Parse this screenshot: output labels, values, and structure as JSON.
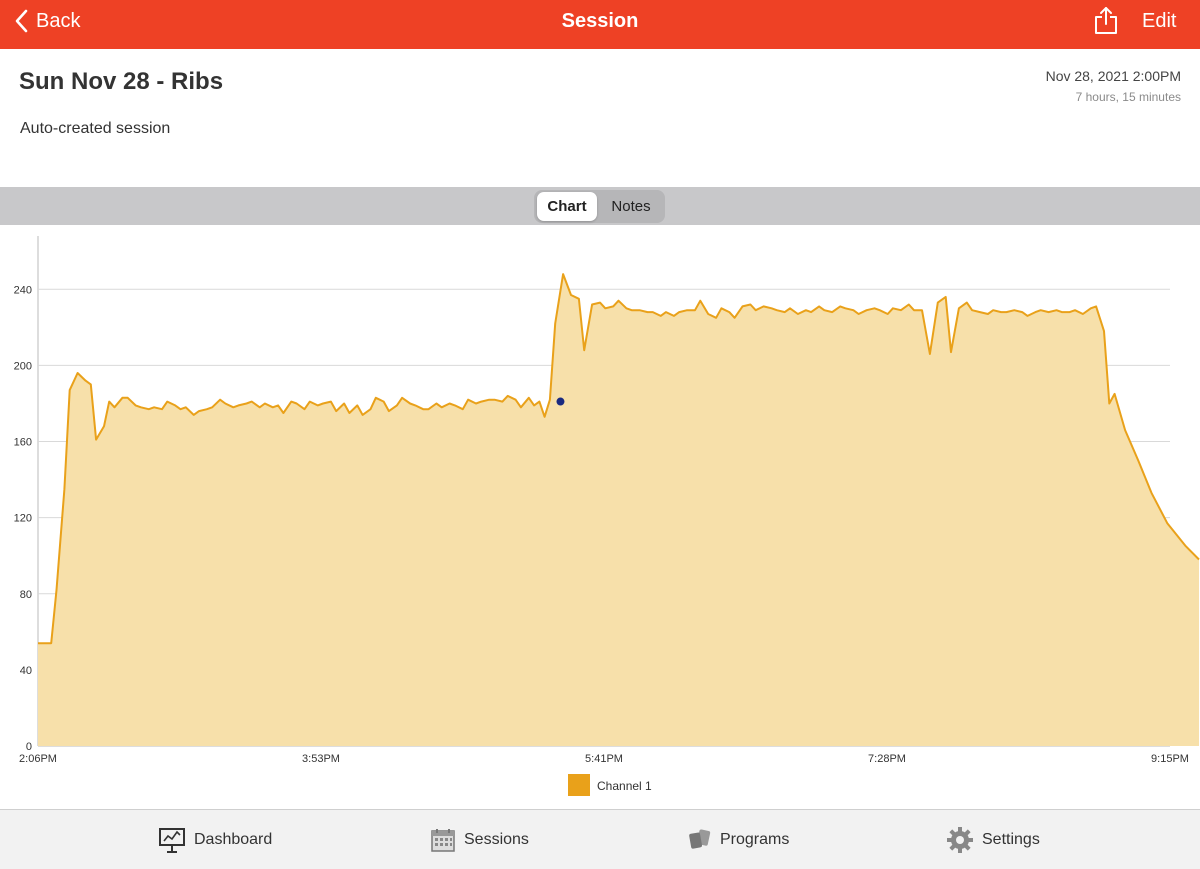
{
  "nav": {
    "back_label": "Back",
    "title": "Session",
    "edit_label": "Edit",
    "share_icon": "share-icon"
  },
  "session": {
    "title": "Sun Nov 28 - Ribs",
    "date": "Nov 28, 2021 2:00PM",
    "duration": "7 hours, 15 minutes",
    "description": "Auto-created session"
  },
  "segments": {
    "chart": "Chart",
    "notes": "Notes",
    "selected": "Chart"
  },
  "colors": {
    "accent": "#ee4125",
    "series_line": "#e9a11a",
    "series_fill": "#f7e0aa",
    "marker": "#1a2a80"
  },
  "chart_data": {
    "type": "area",
    "x_ticks": [
      "2:06PM",
      "3:53PM",
      "5:41PM",
      "7:28PM",
      "9:15PM"
    ],
    "y_ticks": [
      0,
      40,
      80,
      120,
      160,
      200,
      240
    ],
    "ylim": [
      0,
      268
    ],
    "x_range_minutes": [
      0,
      429
    ],
    "grid": true,
    "legend_position": "bottom-center",
    "series": [
      {
        "name": "Channel 1",
        "marker_point": [
          198,
          181
        ],
        "points": [
          [
            0,
            54
          ],
          [
            5,
            54
          ],
          [
            7,
            82
          ],
          [
            10,
            135
          ],
          [
            12,
            187
          ],
          [
            15,
            196
          ],
          [
            18,
            192
          ],
          [
            20,
            190
          ],
          [
            22,
            161
          ],
          [
            25,
            168
          ],
          [
            27,
            181
          ],
          [
            29,
            178
          ],
          [
            32,
            183
          ],
          [
            34,
            183
          ],
          [
            37,
            179
          ],
          [
            39,
            178
          ],
          [
            42,
            177
          ],
          [
            44,
            178
          ],
          [
            47,
            177
          ],
          [
            49,
            181
          ],
          [
            52,
            179
          ],
          [
            54,
            177
          ],
          [
            56,
            178
          ],
          [
            59,
            174
          ],
          [
            61,
            176
          ],
          [
            64,
            177
          ],
          [
            66,
            178
          ],
          [
            69,
            182
          ],
          [
            71,
            180
          ],
          [
            74,
            178
          ],
          [
            76,
            179
          ],
          [
            79,
            180
          ],
          [
            81,
            181
          ],
          [
            84,
            178
          ],
          [
            86,
            180
          ],
          [
            89,
            178
          ],
          [
            91,
            179
          ],
          [
            93,
            175
          ],
          [
            96,
            181
          ],
          [
            98,
            180
          ],
          [
            101,
            177
          ],
          [
            103,
            181
          ],
          [
            106,
            179
          ],
          [
            108,
            180
          ],
          [
            111,
            181
          ],
          [
            113,
            176
          ],
          [
            116,
            180
          ],
          [
            118,
            175
          ],
          [
            121,
            179
          ],
          [
            123,
            174
          ],
          [
            126,
            177
          ],
          [
            128,
            183
          ],
          [
            131,
            181
          ],
          [
            133,
            176
          ],
          [
            136,
            179
          ],
          [
            138,
            183
          ],
          [
            141,
            180
          ],
          [
            143,
            179
          ],
          [
            146,
            177
          ],
          [
            148,
            177
          ],
          [
            151,
            180
          ],
          [
            153,
            178
          ],
          [
            156,
            180
          ],
          [
            158,
            179
          ],
          [
            161,
            177
          ],
          [
            163,
            182
          ],
          [
            166,
            180
          ],
          [
            168,
            181
          ],
          [
            171,
            182
          ],
          [
            173,
            182
          ],
          [
            176,
            181
          ],
          [
            178,
            184
          ],
          [
            181,
            182
          ],
          [
            183,
            178
          ],
          [
            186,
            183
          ],
          [
            188,
            179
          ],
          [
            190,
            181
          ],
          [
            192,
            173
          ],
          [
            194,
            182
          ],
          [
            196,
            222
          ],
          [
            199,
            248
          ],
          [
            202,
            237
          ],
          [
            205,
            235
          ],
          [
            207,
            208
          ],
          [
            210,
            232
          ],
          [
            213,
            233
          ],
          [
            215,
            230
          ],
          [
            218,
            231
          ],
          [
            220,
            234
          ],
          [
            223,
            230
          ],
          [
            225,
            229
          ],
          [
            228,
            229
          ],
          [
            231,
            228
          ],
          [
            233,
            228
          ],
          [
            236,
            226
          ],
          [
            238,
            228
          ],
          [
            241,
            226
          ],
          [
            243,
            228
          ],
          [
            246,
            229
          ],
          [
            249,
            229
          ],
          [
            251,
            234
          ],
          [
            254,
            227
          ],
          [
            257,
            225
          ],
          [
            259,
            230
          ],
          [
            262,
            228
          ],
          [
            264,
            225
          ],
          [
            267,
            231
          ],
          [
            270,
            232
          ],
          [
            272,
            229
          ],
          [
            275,
            231
          ],
          [
            278,
            230
          ],
          [
            280,
            229
          ],
          [
            283,
            228
          ],
          [
            285,
            230
          ],
          [
            288,
            227
          ],
          [
            291,
            229
          ],
          [
            293,
            228
          ],
          [
            296,
            231
          ],
          [
            298,
            229
          ],
          [
            301,
            228
          ],
          [
            304,
            231
          ],
          [
            306,
            230
          ],
          [
            309,
            229
          ],
          [
            311,
            227
          ],
          [
            314,
            229
          ],
          [
            317,
            230
          ],
          [
            319,
            229
          ],
          [
            322,
            227
          ],
          [
            324,
            230
          ],
          [
            327,
            229
          ],
          [
            330,
            232
          ],
          [
            332,
            229
          ],
          [
            335,
            229
          ],
          [
            338,
            206
          ],
          [
            341,
            233
          ],
          [
            344,
            236
          ],
          [
            346,
            207
          ],
          [
            349,
            230
          ],
          [
            352,
            233
          ],
          [
            354,
            229
          ],
          [
            357,
            228
          ],
          [
            360,
            227
          ],
          [
            362,
            229
          ],
          [
            365,
            228
          ],
          [
            367,
            228
          ],
          [
            370,
            229
          ],
          [
            373,
            228
          ],
          [
            375,
            226
          ],
          [
            378,
            228
          ],
          [
            380,
            229
          ],
          [
            383,
            228
          ],
          [
            386,
            229
          ],
          [
            388,
            228
          ],
          [
            391,
            228
          ],
          [
            393,
            229
          ],
          [
            396,
            227
          ],
          [
            399,
            230
          ],
          [
            401,
            231
          ],
          [
            404,
            218
          ],
          [
            406,
            180
          ],
          [
            408,
            185
          ],
          [
            412,
            166
          ],
          [
            417,
            150
          ],
          [
            422,
            133
          ],
          [
            428,
            117
          ],
          [
            435,
            105
          ],
          [
            440,
            98
          ]
        ]
      }
    ]
  },
  "legend": {
    "label": "Channel 1"
  },
  "tabs": {
    "dashboard": "Dashboard",
    "sessions": "Sessions",
    "programs": "Programs",
    "settings": "Settings"
  }
}
